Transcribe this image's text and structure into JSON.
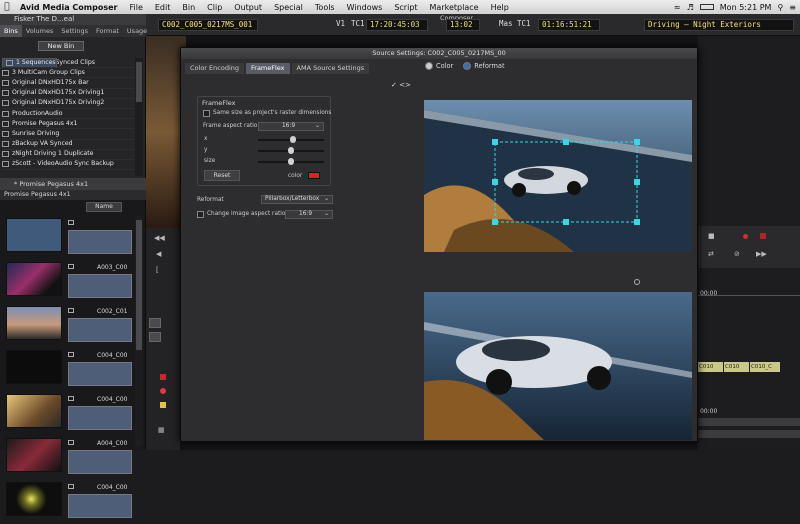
{
  "menubar": {
    "app": "Avid Media Composer",
    "items": [
      "File",
      "Edit",
      "Bin",
      "Clip",
      "Output",
      "Special",
      "Tools",
      "Windows",
      "Script",
      "Marketplace",
      "Help"
    ],
    "clock": "Mon 5:21 PM"
  },
  "toolbar": {
    "title": "Composer",
    "clip_name": "C002_C005_0217MS_001",
    "v1": "V1",
    "tc1": "TC1",
    "tc1_value": "17:20:45:03",
    "frames": "13:02",
    "mas_label": "Mas",
    "mas_tc": "TC1",
    "mas_value": "01:16:51:21",
    "sequence": "Driving – Night Exteriors"
  },
  "bin": {
    "title": "Fisker The D...eal",
    "tabs": [
      "Bins",
      "Volumes",
      "Settings",
      "Format",
      "Usage"
    ],
    "new_bin": "New Bin",
    "items": [
      "1 Sequences",
      "2 Bar Scene - Synced Clips",
      "3 MultiCam Group Clips",
      "Original DNxHD175x Bar",
      "Original DNxHD175x Driving1",
      "Original DNxHD175x Driving2",
      "ProductionAudio",
      "Promise Pegasus 4x1",
      "Sunrise Driving",
      "zBackup VA Synced",
      "zNight Driving 1 Duplicate",
      "zScott - VideoAudio Sync Backup"
    ]
  },
  "bin2": {
    "title": "* Promise Pegasus 4x1",
    "tab": "Promise Pegasus 4x1",
    "button": "Name",
    "clips": [
      "",
      "A003_C00",
      "C002_C01",
      "C004_C00",
      "C004_C00",
      "A004_C00",
      "C004_C00"
    ]
  },
  "modal": {
    "title": "Source Settings: C002_C005_0217MS_00",
    "tabs": [
      "Color Encoding",
      "FrameFlex",
      "AMA Source Settings"
    ],
    "active_tab": "FrameFlex",
    "radio_color": "Color",
    "radio_reformat": "Reformat",
    "frameflex": {
      "heading": "FrameFlex",
      "same_size": "Same size as project's raster dimensions",
      "aspect_label": "Frame aspect ratio",
      "aspect_value": "16:9",
      "x_label": "x",
      "y_label": "y",
      "size_label": "size",
      "reset": "Reset",
      "color_label": "color",
      "color_value": "#e02020"
    },
    "reformat_label": "Reformat",
    "reformat_value": "Pillarbox/Letterbox",
    "change_ratio_label": "Change image aspect ratio",
    "change_ratio_value": "16:9"
  },
  "timeline": {
    "tc_a": "00:00",
    "tc_b": "00:00",
    "clips": [
      "C010",
      "C010",
      "C010_C"
    ]
  },
  "colors": {
    "accent": "#3a6fb0",
    "handle": "#39d6e8",
    "timecode": "#e9e25e"
  }
}
